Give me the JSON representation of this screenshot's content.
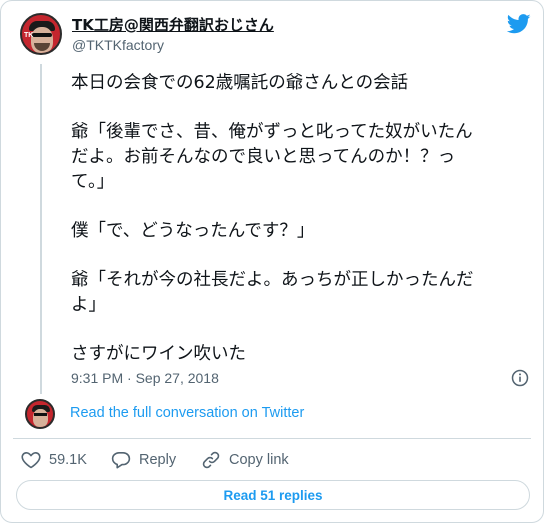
{
  "author": {
    "display_name": "TK工房@関西弁翻訳おじさん",
    "handle": "@TKTKfactory",
    "avatar_letters": "TK"
  },
  "tweet": {
    "paragraphs": [
      "本日の会食での62歳嘱託の爺さんとの会話",
      "爺「後輩でさ、昔、俺がずっと叱ってた奴がいたん\nだよ。お前そんなので良いと思ってんのか！？っ\nて。」",
      "僕「で、どうなったんです？」",
      "爺「それが今の社長だよ。あっちが正しかったんだ\nよ」",
      "さすがにワイン吹いた"
    ],
    "timestamp": "9:31 PM · Sep 27, 2018"
  },
  "conversation_link": "Read the full conversation on Twitter",
  "actions": {
    "likes": "59.1K",
    "reply": "Reply",
    "copy_link": "Copy link"
  },
  "read_replies": "Read 51 replies",
  "colors": {
    "brand_blue": "#1d9bf0",
    "like_red": "#f91880",
    "text_gray": "#536471",
    "border": "#cfd9de"
  },
  "icons": [
    "twitter-bird-icon",
    "info-icon",
    "heart-icon",
    "speech-bubble-icon",
    "link-icon"
  ]
}
